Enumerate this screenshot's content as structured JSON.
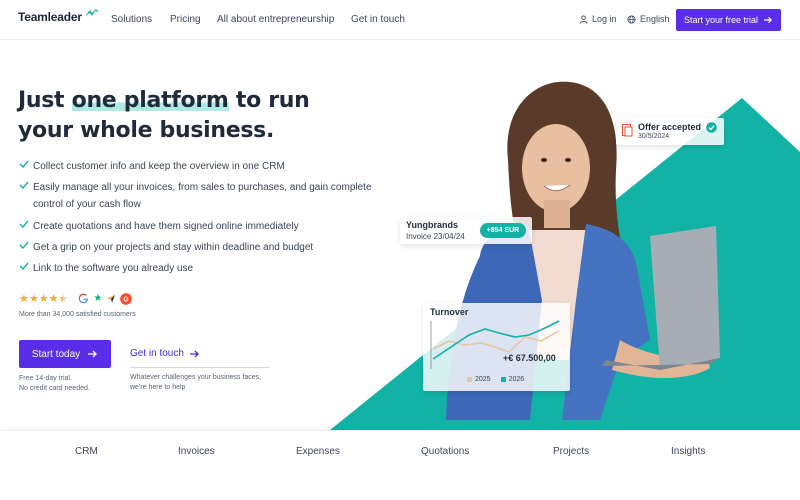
{
  "header": {
    "logo": "Teamleader",
    "nav": [
      "Solutions",
      "Pricing",
      "All about entrepreneurship",
      "Get in touch"
    ],
    "login": "Log in",
    "language": "English",
    "trial_button": "Start your free trial"
  },
  "hero": {
    "headline_pre": "Just ",
    "headline_highlight": "one platform",
    "headline_post": " to run",
    "headline_line2": "your whole business.",
    "features": [
      "Collect customer info and keep the overview in one CRM",
      "Easily manage all your invoices, from sales to purchases, and gain complete control of your cash flow",
      "Create quotations and have them signed online immediately",
      "Get a grip on your projects and stay within deadline and budget",
      "Link to the software you already use"
    ],
    "rating_stars": 4.5,
    "rating_text": "More than 34,000 satisfied customers",
    "cta_button": "Start today",
    "cta_note_line1": "Free 14-day trial.",
    "cta_note_line2": "No credit card needed.",
    "secondary_link": "Get in touch",
    "secondary_note_line1": "Whatever challenges your business faces,",
    "secondary_note_line2": "we're here to help"
  },
  "cards": {
    "offer_title": "Offer accepted",
    "offer_date": "30/5/2024",
    "yung_title": "Yungbrands",
    "yung_sub": "Invoice 23/04/24",
    "yung_amount": "+854 EUR",
    "turnover_title": "Turnover",
    "turnover_value": "+€ 67.500,00",
    "legend_2025": "2025",
    "legend_2026": "2026"
  },
  "colors": {
    "brand_purple": "#5a2ee8",
    "teal": "#14b1a5",
    "highlight": "#aee9e4",
    "star": "#f4a93c"
  },
  "tabs": [
    "CRM",
    "Invoices",
    "Expenses",
    "Quotations",
    "Projects",
    "Insights"
  ]
}
